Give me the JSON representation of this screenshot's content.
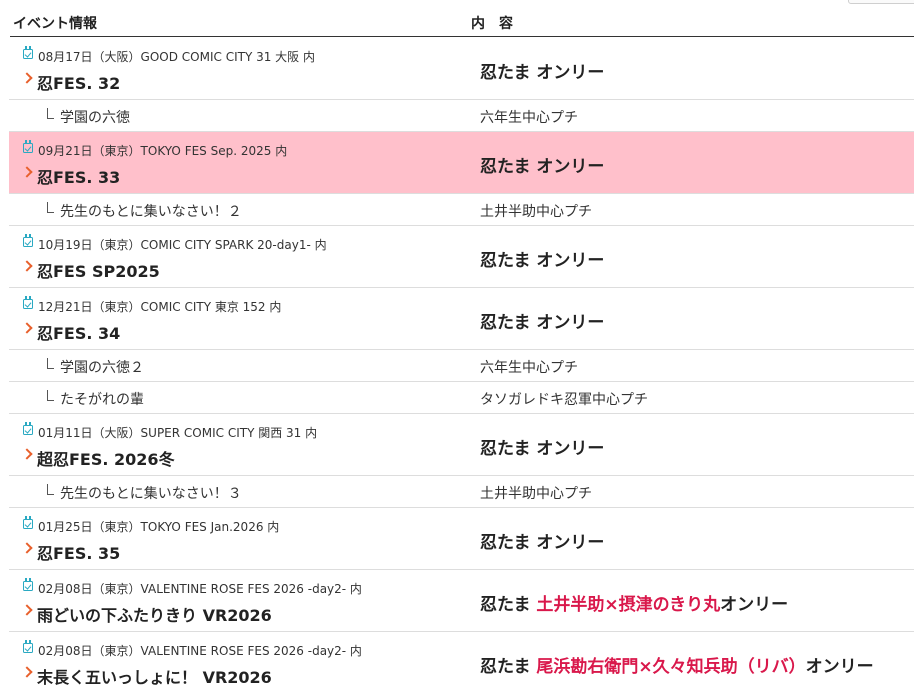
{
  "header": {
    "event_label": "イベント情報",
    "content_label": "内　容"
  },
  "events": [
    {
      "date": "08月17日（大阪）GOOD COMIC CITY 31 大阪 内",
      "title": "忍FES. 32",
      "content": "忍たま オンリー",
      "highlight": false,
      "subs": [
        {
          "title": "学園の六徳",
          "content": "六年生中心プチ"
        }
      ]
    },
    {
      "date": "09月21日（東京）TOKYO FES Sep. 2025 内",
      "title": "忍FES. 33",
      "content": "忍たま オンリー",
      "highlight": true,
      "subs": [
        {
          "title": "先生のもとに集いなさい！２",
          "content": "土井半助中心プチ"
        }
      ]
    },
    {
      "date": "10月19日（東京）COMIC CITY SPARK 20-day1- 内",
      "title": "忍FES SP2025",
      "content": "忍たま オンリー",
      "highlight": false,
      "subs": []
    },
    {
      "date": "12月21日（東京）COMIC CITY 東京 152 内",
      "title": "忍FES. 34",
      "content": "忍たま オンリー",
      "highlight": false,
      "subs": [
        {
          "title": "学園の六徳２",
          "content": "六年生中心プチ"
        },
        {
          "title": "たそがれの輩",
          "content": "タソガレドキ忍軍中心プチ"
        }
      ]
    },
    {
      "date": "01月11日（大阪）SUPER COMIC CITY 関西 31 内",
      "title": "超忍FES. 2026冬",
      "content": "忍たま オンリー",
      "highlight": false,
      "subs": [
        {
          "title": "先生のもとに集いなさい！３",
          "content": "土井半助中心プチ"
        }
      ]
    },
    {
      "date": "01月25日（東京）TOKYO FES Jan.2026 内",
      "title": "忍FES. 35",
      "content": "忍たま オンリー",
      "highlight": false,
      "subs": []
    },
    {
      "date": "02月08日（東京）VALENTINE ROSE FES 2026 -day2- 内",
      "title": "雨どいの下ふたりきり VR2026",
      "content_prefix": "忍たま ",
      "content_red": "土井半助×摂津のきり丸",
      "content_suffix": "オンリー",
      "highlight": false,
      "subs": []
    },
    {
      "date": "02月08日（東京）VALENTINE ROSE FES 2026 -day2- 内",
      "title": "末長く五いっしょに！ VR2026",
      "content_prefix": "忍たま ",
      "content_red": "尾浜勘右衛門×久々知兵助（リバ）",
      "content_suffix": "オンリー",
      "highlight": false,
      "subs": []
    }
  ],
  "colors": {
    "highlight": "#ffc0cb",
    "accent_arrow": "#e8602c",
    "calendar_icon": "#2aa9c2",
    "pair_text": "#d9184b"
  }
}
